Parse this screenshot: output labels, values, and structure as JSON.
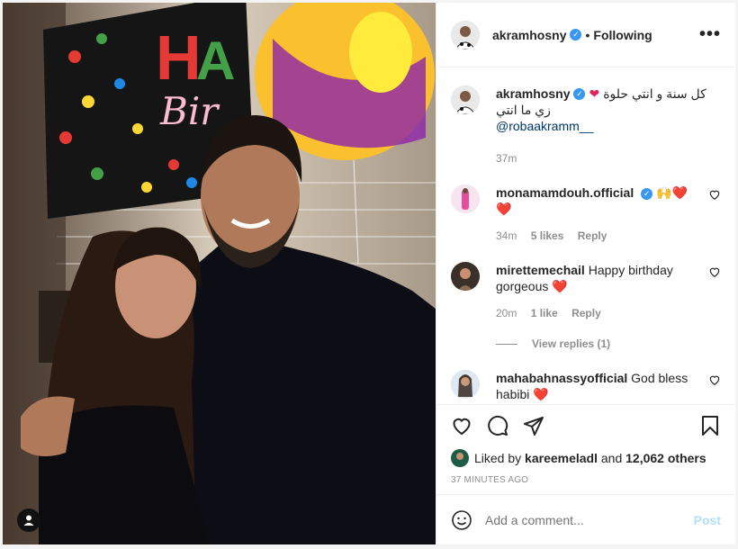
{
  "post": {
    "author": "akramhosny",
    "verified_mark": "✓",
    "separator": "•",
    "follow_state": "Following",
    "more_icon": "more-options-icon",
    "caption_line1": "كل سنة و انتي حلوة",
    "caption_line2": "زي ما انتي",
    "caption_mention": "@robaakramm__",
    "caption_time": "37m"
  },
  "comments": [
    {
      "user": "monamamdouh.official",
      "text": "🙌❤️",
      "text2": "❤️",
      "time": "34m",
      "likes": "5 likes",
      "reply": "Reply"
    },
    {
      "user": "mirettemechail",
      "text": "Happy birthday gorgeous ❤️",
      "time": "20m",
      "likes": "1 like",
      "reply": "Reply",
      "view_replies": "View replies (1)"
    },
    {
      "user": "mahabahnassyofficial",
      "text": "God bless habibi ❤️"
    }
  ],
  "likes": {
    "prefix": "Liked by",
    "user": "kareemeladl",
    "and": "and",
    "count": "12,062 others"
  },
  "timestamp": "37 MINUTES AGO",
  "add_comment": {
    "placeholder": "Add a comment...",
    "post_label": "Post"
  },
  "colors": {
    "verified": "#3897f0",
    "link": "#00376b",
    "muted": "#8e8e8e",
    "post_disabled": "#b2dffc"
  }
}
